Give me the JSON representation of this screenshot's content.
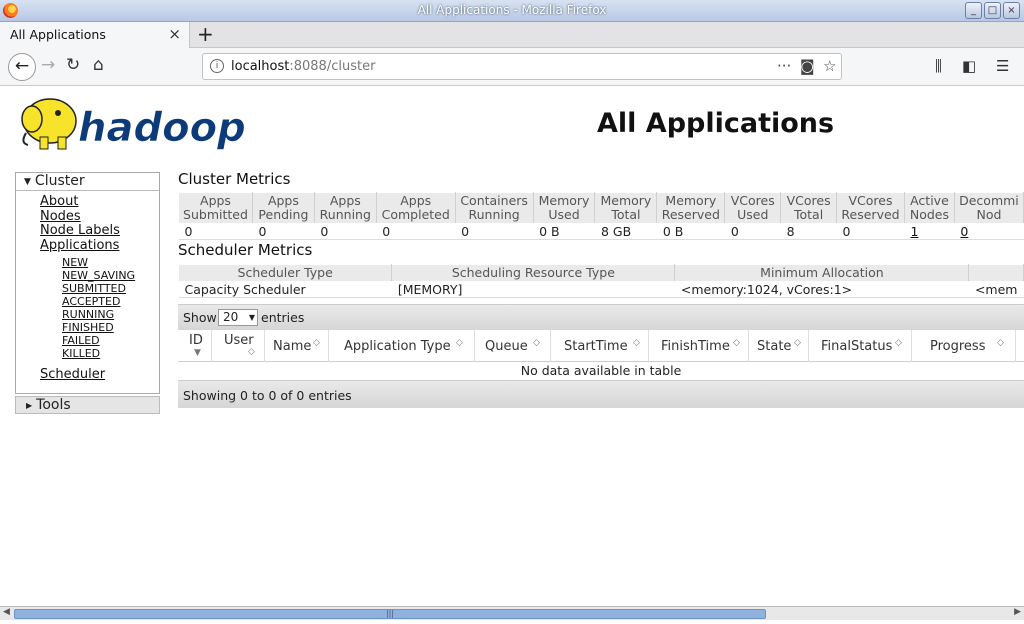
{
  "window": {
    "title": "All Applications - Mozilla Firefox"
  },
  "tab": {
    "label": "All Applications",
    "close": "×",
    "new": "+"
  },
  "nav": {
    "url_host": "localhost",
    "url_rest": ":8088/cluster",
    "more": "···"
  },
  "page": {
    "title": "All Applications"
  },
  "sidebar": {
    "cluster_label": "Cluster",
    "links": [
      "About",
      "Nodes",
      "Node Labels",
      "Applications"
    ],
    "app_states": [
      "NEW",
      "NEW_SAVING",
      "SUBMITTED",
      "ACCEPTED",
      "RUNNING",
      "FINISHED",
      "FAILED",
      "KILLED"
    ],
    "scheduler": "Scheduler",
    "tools_label": "Tools"
  },
  "cluster_metrics": {
    "title": "Cluster Metrics",
    "headers": [
      [
        "Apps",
        "Submitted"
      ],
      [
        "Apps",
        "Pending"
      ],
      [
        "Apps",
        "Running"
      ],
      [
        "Apps",
        "Completed"
      ],
      [
        "Containers",
        "Running"
      ],
      [
        "Memory",
        "Used"
      ],
      [
        "Memory",
        "Total"
      ],
      [
        "Memory",
        "Reserved"
      ],
      [
        "VCores",
        "Used"
      ],
      [
        "VCores",
        "Total"
      ],
      [
        "VCores",
        "Reserved"
      ],
      [
        "Active",
        "Nodes"
      ],
      [
        "Decommi",
        "Nod"
      ]
    ],
    "values": [
      "0",
      "0",
      "0",
      "0",
      "0",
      "0 B",
      "8 GB",
      "0 B",
      "0",
      "8",
      "0",
      "1",
      "0"
    ]
  },
  "scheduler_metrics": {
    "title": "Scheduler Metrics",
    "headers": [
      "Scheduler Type",
      "Scheduling Resource Type",
      "Minimum Allocation",
      ""
    ],
    "values": [
      "Capacity Scheduler",
      "[MEMORY]",
      "<memory:1024, vCores:1>",
      "<mem"
    ]
  },
  "apps_table": {
    "show_label": "Show",
    "page_size": "20",
    "entries_label": "entries",
    "columns": [
      "ID",
      "User",
      "Name",
      "Application Type",
      "Queue",
      "StartTime",
      "FinishTime",
      "State",
      "FinalStatus",
      "Progress"
    ],
    "empty_message": "No data available in table",
    "info": "Showing 0 to 0 of 0 entries"
  }
}
